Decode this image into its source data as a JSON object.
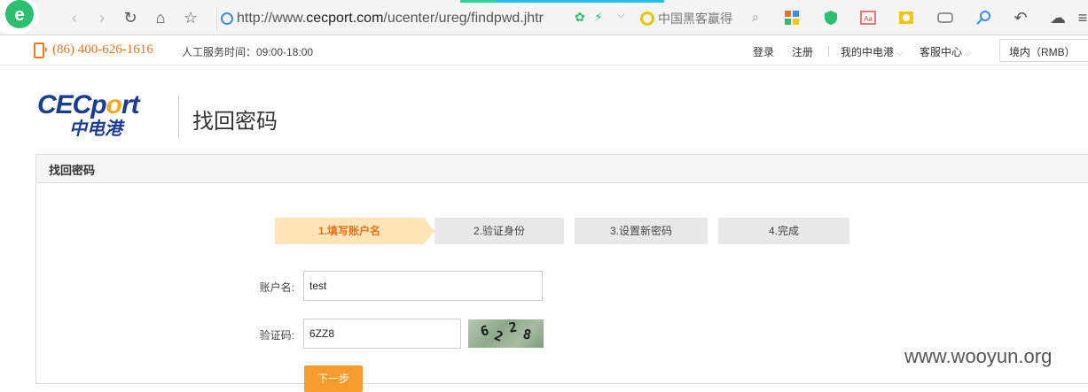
{
  "browser": {
    "url_prefix": "http://www.",
    "url_host": "cecport.com",
    "url_path": "/ucenter/ureg/findpwd.jhtr",
    "search_text": "中国黑客赢得"
  },
  "topbar": {
    "phone": "(86) 400-626-1616",
    "service_hours": "人工服务时间：09:00-18:00",
    "login": "登录",
    "register": "注册",
    "my_account": "我的中电港",
    "customer_service": "客服中心",
    "currency": "境内（RMB）"
  },
  "header": {
    "logo_en_1": "CEC",
    "logo_en_2": "p",
    "logo_en_3": "o",
    "logo_en_4": "rt",
    "logo_cn": "中电港",
    "page_title": "找回密码"
  },
  "panel": {
    "title": "找回密码"
  },
  "steps": [
    {
      "label": "1.填写账户名"
    },
    {
      "label": "2.验证身份"
    },
    {
      "label": "3.设置新密码"
    },
    {
      "label": "4.完成"
    }
  ],
  "form": {
    "account_label": "账户名:",
    "account_value": "test",
    "captcha_label": "验证码:",
    "captcha_value": "6ZZ8",
    "captcha_chars": [
      "6",
      "2",
      "2",
      "8"
    ],
    "next_label": "下一步"
  },
  "watermark": "www.wooyun.org",
  "colors": {
    "accent_orange": "#e8731a",
    "button_orange": "#f79b2c",
    "brand_blue": "#1a3d8f"
  }
}
